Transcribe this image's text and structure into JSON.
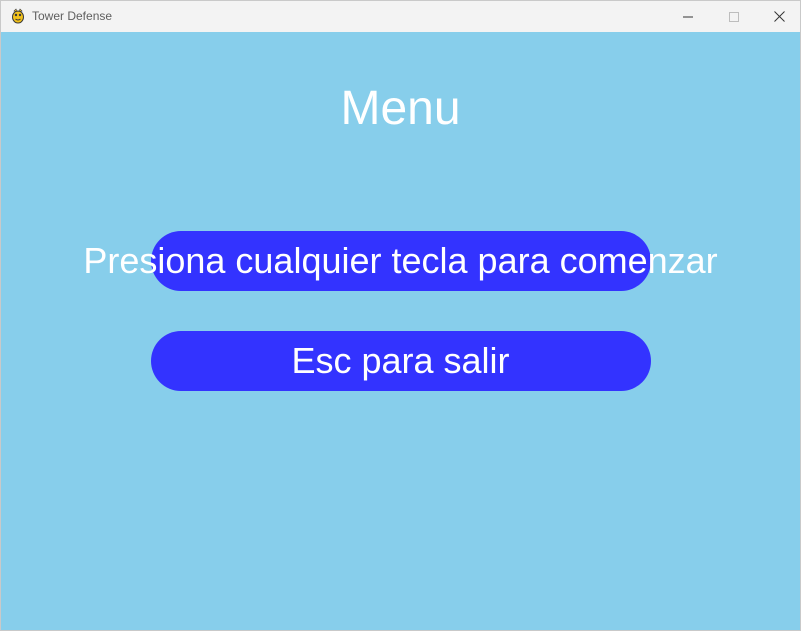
{
  "window": {
    "title": "Tower Defense",
    "controls": {
      "minimize_icon": "minimize-icon",
      "maximize_icon": "maximize-icon",
      "close_icon": "close-icon"
    }
  },
  "game": {
    "background_color": "#87ceeb",
    "menu_title": "Menu",
    "start_prompt": "Presiona cualquier tecla para comenzar",
    "quit_prompt": "Esc para salir",
    "button_color": "#3333ff",
    "text_color": "#ffffff"
  }
}
